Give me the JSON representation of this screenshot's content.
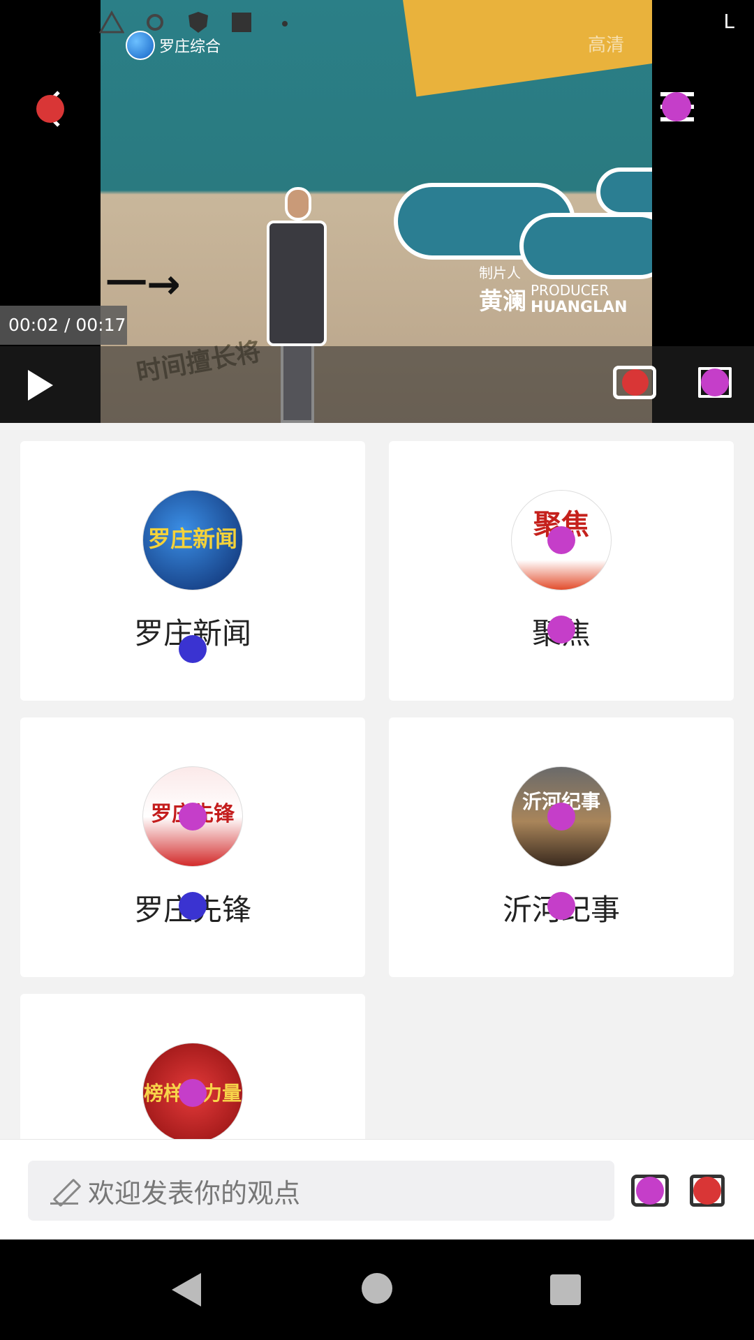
{
  "player": {
    "channel_name": "罗庄综合",
    "hd_label": "高清",
    "time_display": "00:02 / 00:17",
    "producer_cn_label": "制片人",
    "producer_cn_name": "黄澜",
    "producer_en_label": "PRODUCER",
    "producer_en_name": "HUANGLAN",
    "scribble_text": "时间擅长将",
    "arrow_text": "一→",
    "status_right": "L"
  },
  "cards": [
    {
      "title": "罗庄新闻",
      "thumb_text": "罗庄新闻",
      "thumb_color": "#1c4fa6"
    },
    {
      "title": "聚焦",
      "thumb_text": "聚焦",
      "thumb_color": "#ffffff"
    },
    {
      "title": "罗庄先锋",
      "thumb_text": "罗庄先锋",
      "thumb_color": "#ffffff"
    },
    {
      "title": "沂河纪事",
      "thumb_text": "沂河纪事",
      "thumb_color": "#4a3a2e"
    },
    {
      "title": "",
      "thumb_text": "榜样的力量",
      "thumb_color": "#b81d1d"
    }
  ],
  "comment": {
    "placeholder": "欢迎发表你的观点"
  },
  "icons": {
    "back": "back-arrow-icon",
    "more": "more-menu-icon",
    "play": "play-icon",
    "cast": "cast-icon",
    "fullscreen": "fullscreen-icon",
    "pen": "pen-icon",
    "comment": "comment-icon",
    "share": "share-icon"
  }
}
